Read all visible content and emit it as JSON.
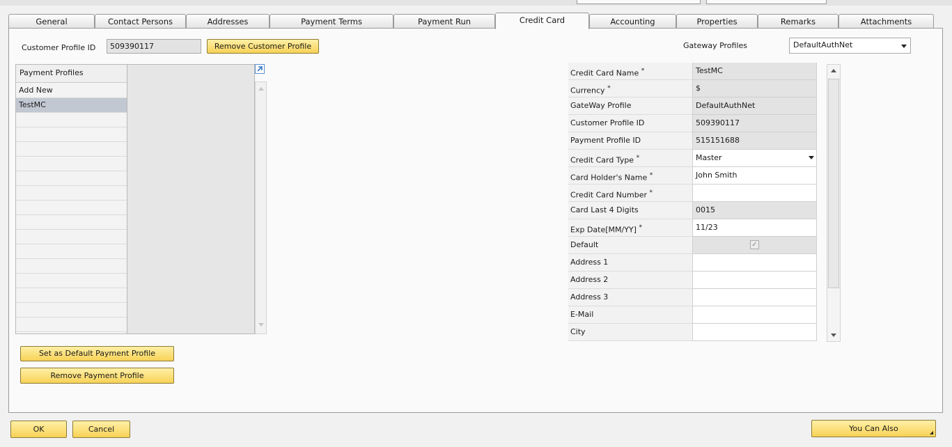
{
  "tabs": [
    {
      "label": "General"
    },
    {
      "label": "Contact Persons"
    },
    {
      "label": "Addresses"
    },
    {
      "label": "Payment Terms"
    },
    {
      "label": "Payment Run"
    },
    {
      "label": "Credit Card"
    },
    {
      "label": "Accounting"
    },
    {
      "label": "Properties"
    },
    {
      "label": "Remarks"
    },
    {
      "label": "Attachments"
    }
  ],
  "header": {
    "customer_profile_label": "Customer Profile ID",
    "customer_profile_value": "509390117",
    "remove_customer_profile_label": "Remove Customer Profile",
    "gateway_profiles_label": "Gateway Profiles",
    "gateway_profiles_value": "DefaultAuthNet"
  },
  "payment_profiles": {
    "header": "Payment Profiles",
    "rows": [
      "Add New",
      "TestMC",
      "",
      "",
      "",
      "",
      "",
      "",
      "",
      "",
      "",
      "",
      "",
      "",
      "",
      "",
      ""
    ],
    "selected_index": 1
  },
  "buttons": {
    "set_default": "Set as Default Payment Profile",
    "remove_payment": "Remove Payment Profile",
    "ok": "OK",
    "cancel": "Cancel",
    "you_can_also": "You Can Also"
  },
  "details": [
    {
      "label": "Credit Card Name",
      "required": true,
      "value": "TestMC"
    },
    {
      "label": "Currency",
      "required": true,
      "value": "$"
    },
    {
      "label": "GateWay Profile",
      "required": false,
      "value": "DefaultAuthNet"
    },
    {
      "label": "Customer Profile ID",
      "required": false,
      "value": "509390117"
    },
    {
      "label": "Payment Profile ID",
      "required": false,
      "value": "515151688"
    },
    {
      "label": "Credit Card Type",
      "required": true,
      "value": "Master"
    },
    {
      "label": "Card Holder's Name",
      "required": true,
      "value": "John Smith"
    },
    {
      "label": "Credit Card Number",
      "required": true,
      "value": ""
    },
    {
      "label": "Card Last 4 Digits",
      "required": false,
      "value": "0015"
    },
    {
      "label": "Exp Date[MM/YY]",
      "required": true,
      "value": "11/23"
    },
    {
      "label": "Default",
      "required": false,
      "value": "✓"
    },
    {
      "label": "Address 1",
      "required": false,
      "value": ""
    },
    {
      "label": "Address 2",
      "required": false,
      "value": ""
    },
    {
      "label": "Address 3",
      "required": false,
      "value": ""
    },
    {
      "label": "E-Mail",
      "required": false,
      "value": ""
    },
    {
      "label": "City",
      "required": false,
      "value": ""
    }
  ],
  "required_marker": "*",
  "icons": {
    "expand": "expand-arrow-icon",
    "dropdown": "chevron-down-icon",
    "checkbox": "checkbox-checked-icon"
  },
  "colors": {
    "accent_yellow": "#f8d257",
    "selected_row": "#c2c8d2",
    "readonly_field": "#e3e3e3"
  }
}
